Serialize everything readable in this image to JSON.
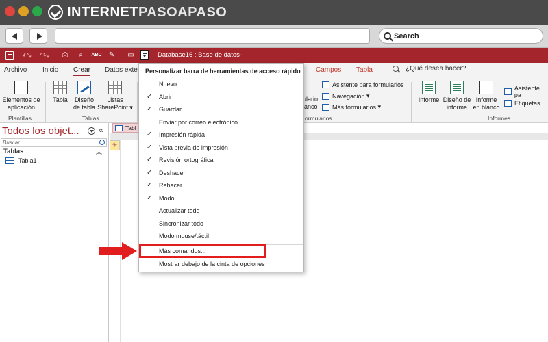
{
  "brand": {
    "part1": "INTERNET",
    "part2": "PASOAPASO"
  },
  "browser": {
    "search_label": "Search"
  },
  "qat": {
    "title": "Database16 : Base de datos-"
  },
  "tabs": [
    {
      "label": "Archivo"
    },
    {
      "label": "Inicio"
    },
    {
      "label": "Crear"
    },
    {
      "label": "Datos exte"
    },
    {
      "label": "Campos"
    },
    {
      "label": "Tabla"
    }
  ],
  "tell_me": "¿Qué desea hacer?",
  "ribbon": {
    "elementos_l1": "Elementos de",
    "elementos_l2": "aplicación",
    "plantillas": "Plantillas",
    "tabla": "Tabla",
    "diseno_tabla_l1": "Diseño",
    "diseno_tabla_l2": "de tabla",
    "listas_l1": "Listas",
    "listas_l2": "SharePoint",
    "tablas_group": "Tablas",
    "formulario_l1": "ulario",
    "formulario_l2": "lanco",
    "asistente_formularios": "Asistente para formularios",
    "navegacion": "Navegación",
    "mas_formularios": "Más formularios",
    "formularios_group": "ormularios",
    "informe": "Informe",
    "diseno_informe_l1": "Diseño de",
    "diseno_informe_l2": "informe",
    "informe_blanco_l1": "Informe",
    "informe_blanco_l2": "en blanco",
    "asistente_informes": "Asistente pa",
    "etiquetas": "Etiquetas",
    "informes_group": "Informes"
  },
  "nav_pane": {
    "title": "Todos los objet...",
    "search_placeholder": "Buscar...",
    "group": "Tablas",
    "items": [
      {
        "label": "Tabla1"
      }
    ]
  },
  "document_tab": {
    "label": "Tabl"
  },
  "menu": {
    "header": "Personalizar barra de herramientas de acceso rápido",
    "items": [
      {
        "label": "Nuevo",
        "checked": ""
      },
      {
        "label": "Abrir",
        "checked": "✓"
      },
      {
        "label": "Guardar",
        "checked": "✓"
      },
      {
        "label": "Enviar por correo electrónico",
        "checked": ""
      },
      {
        "label": "Impresión rápida",
        "checked": "✓"
      },
      {
        "label": "Vista previa de impresión",
        "checked": "✓"
      },
      {
        "label": "Revisión ortográfica",
        "checked": "✓"
      },
      {
        "label": "Deshacer",
        "checked": "✓"
      },
      {
        "label": "Rehacer",
        "checked": "✓"
      },
      {
        "label": "Modo",
        "checked": "✓"
      },
      {
        "label": "Actualizar todo",
        "checked": ""
      },
      {
        "label": "Sincronizar todo",
        "checked": ""
      },
      {
        "label": "Modo mouse/táctil",
        "checked": ""
      },
      {
        "label": "Más comandos...",
        "checked": ""
      },
      {
        "label": "Mostrar debajo de la cinta de opciones",
        "checked": ""
      }
    ]
  },
  "colors": {
    "access_red": "#a4262c",
    "highlight_red": "#e11d1d"
  }
}
